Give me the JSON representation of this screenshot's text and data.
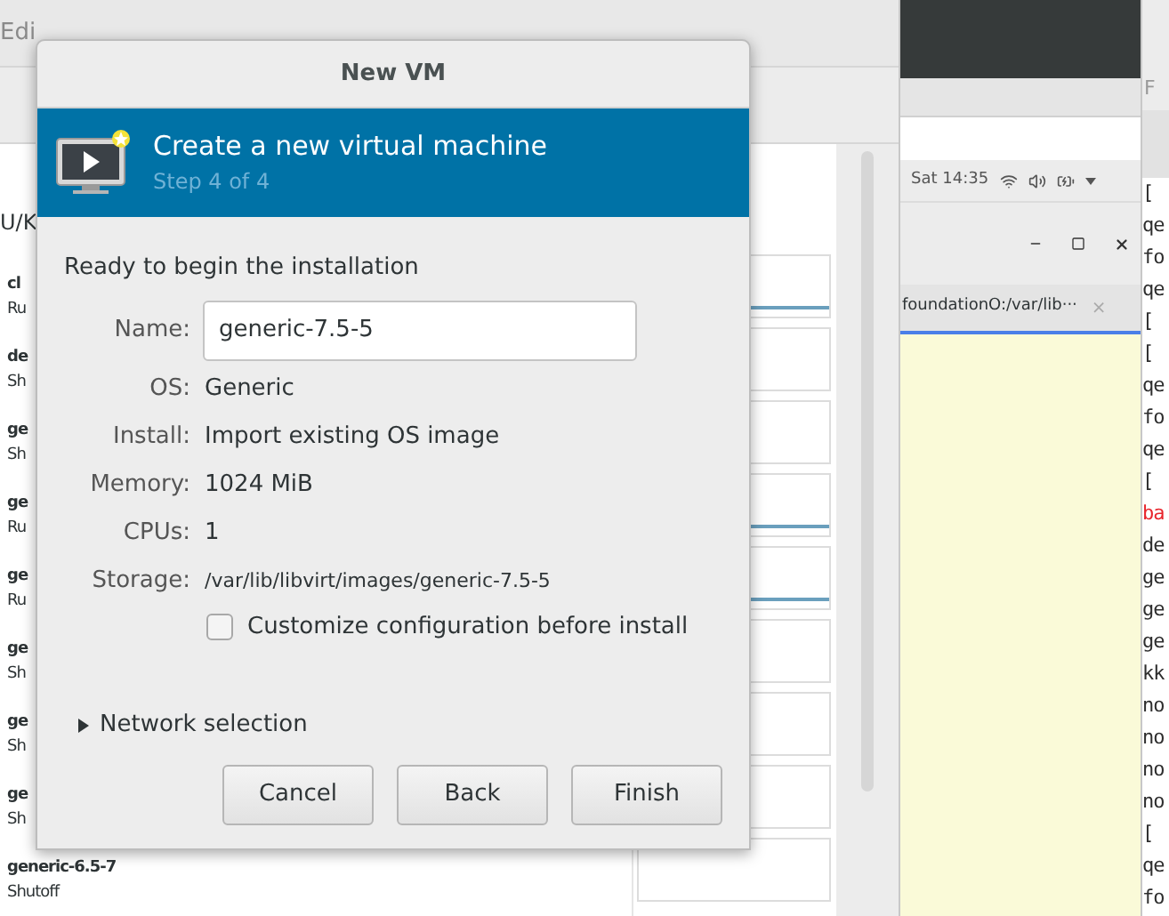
{
  "manager": {
    "menu": "Edi",
    "connection": "U/K",
    "vms": [
      {
        "name": "cl",
        "status": "Ru",
        "running": true
      },
      {
        "name": "de",
        "status": "Sh",
        "running": false
      },
      {
        "name": "ge",
        "status": "Sh",
        "running": false
      },
      {
        "name": "ge",
        "status": "Ru",
        "running": true
      },
      {
        "name": "ge",
        "status": "Ru",
        "running": true
      },
      {
        "name": "ge",
        "status": "Sh",
        "running": false
      },
      {
        "name": "ge",
        "status": "Sh",
        "running": false
      },
      {
        "name": "ge",
        "status": "Sh",
        "running": false
      },
      {
        "name": "generic-6.5-7",
        "status": "Shutoff",
        "running": false
      }
    ]
  },
  "top_bar": {
    "clock": "Sat 14:35"
  },
  "editor": {
    "tab": {
      "title": "foundationO:/var/lib···",
      "close": "×"
    }
  },
  "terminal": {
    "header": "F",
    "lines": [
      {
        "text": "[",
        "color": "#2e2e2e"
      },
      {
        "text": "qe",
        "color": "#2e2e2e"
      },
      {
        "text": "fo",
        "color": "#2e2e2e"
      },
      {
        "text": "qe",
        "color": "#2e2e2e"
      },
      {
        "text": "[",
        "color": "#2e2e2e"
      },
      {
        "text": "[",
        "color": "#2e2e2e"
      },
      {
        "text": "qe",
        "color": "#2e2e2e"
      },
      {
        "text": "fo",
        "color": "#2e2e2e"
      },
      {
        "text": "qe",
        "color": "#2e2e2e"
      },
      {
        "text": "[",
        "color": "#2e2e2e"
      },
      {
        "text": "ba",
        "color": "#e8242b"
      },
      {
        "text": "de",
        "color": "#2e2e2e"
      },
      {
        "text": "ge",
        "color": "#2e2e2e"
      },
      {
        "text": "ge",
        "color": "#2e2e2e"
      },
      {
        "text": "ge",
        "color": "#2e2e2e"
      },
      {
        "text": "kk",
        "color": "#2e2e2e"
      },
      {
        "text": "no",
        "color": "#2e2e2e"
      },
      {
        "text": "no",
        "color": "#2e2e2e"
      },
      {
        "text": "no",
        "color": "#2e2e2e"
      },
      {
        "text": "no",
        "color": "#2e2e2e"
      },
      {
        "text": "[",
        "color": "#2e2e2e"
      },
      {
        "text": "qe",
        "color": "#2e2e2e"
      },
      {
        "text": "fo",
        "color": "#2e2e2e"
      }
    ]
  },
  "dialog": {
    "title": "New VM",
    "heading": "Create a new virtual machine",
    "step": "Step 4 of 4",
    "intro": "Ready to begin the installation",
    "name": {
      "label": "Name:",
      "value": "generic-7.5-5"
    },
    "details": [
      {
        "label": "OS:",
        "value": "Generic",
        "kind": "text"
      },
      {
        "label": "Install:",
        "value": "Import existing OS image",
        "kind": "text"
      },
      {
        "label": "Memory:",
        "value": "1024 MiB",
        "kind": "text"
      },
      {
        "label": "CPUs:",
        "value": "1",
        "kind": "text"
      },
      {
        "label": "Storage:",
        "value": "/var/lib/libvirt/images/generic-7.5-5",
        "kind": "path"
      }
    ],
    "customize": {
      "label": "Customize configuration before install",
      "checked": false
    },
    "network": {
      "label": "Network selection",
      "expanded": false
    },
    "buttons": [
      "Cancel",
      "Back",
      "Finish"
    ]
  }
}
